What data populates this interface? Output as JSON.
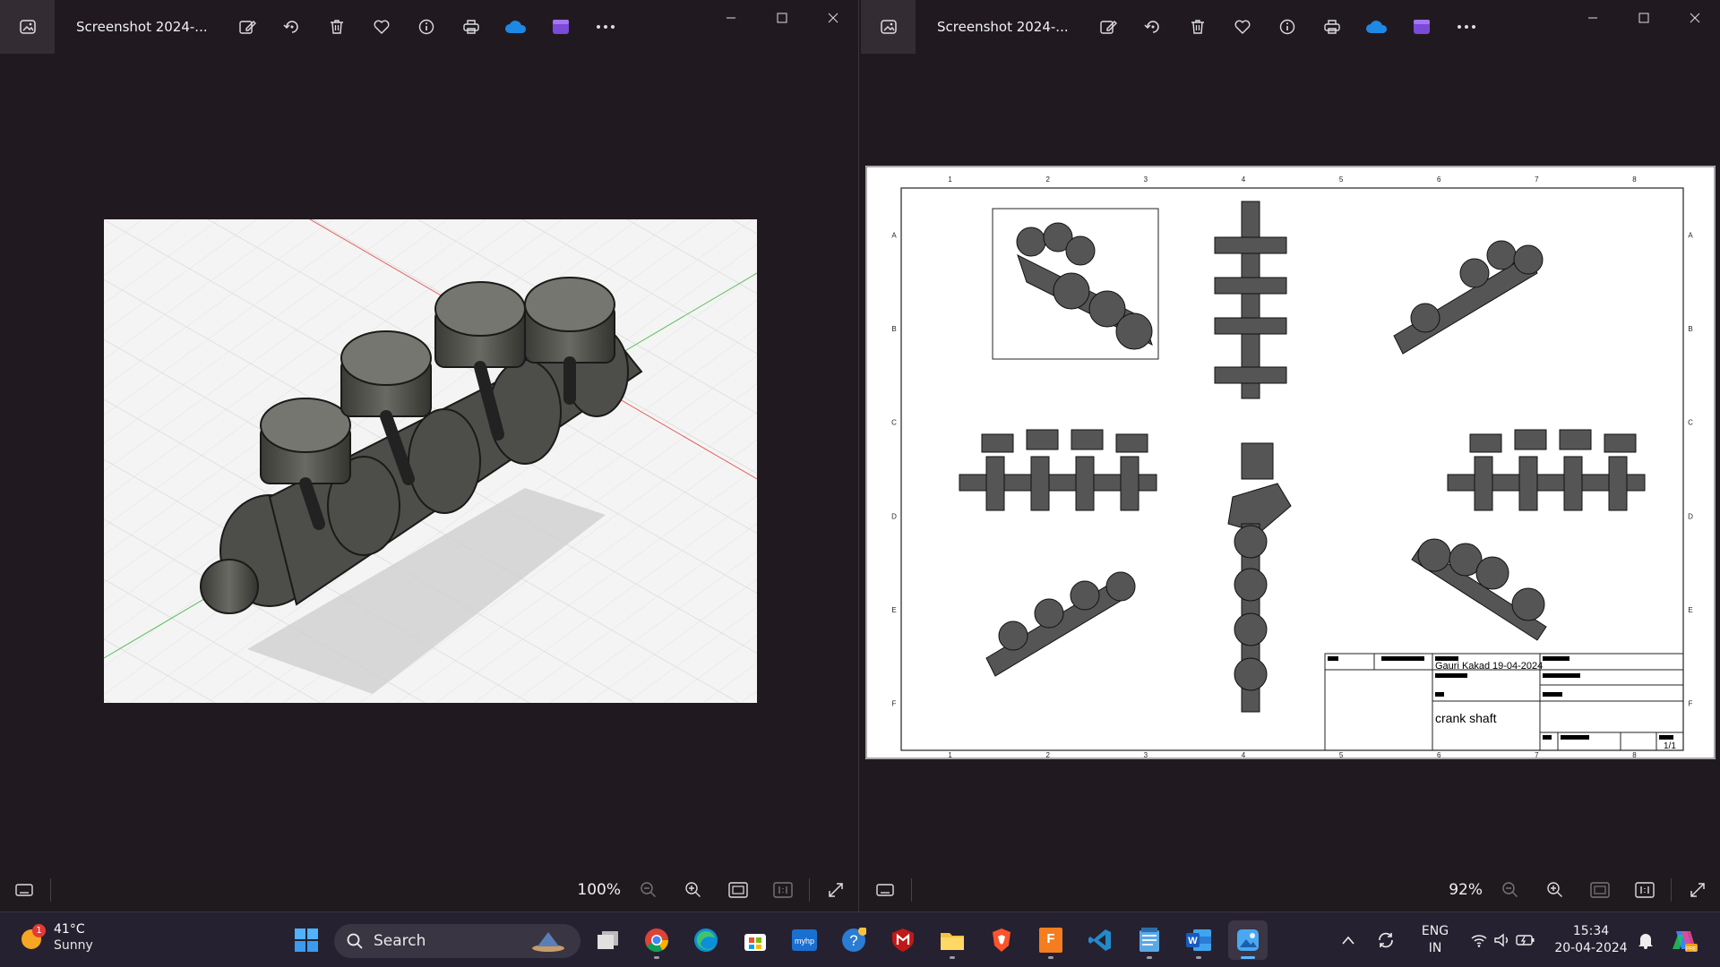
{
  "windows": [
    {
      "title": "Screenshot 2024-...",
      "zoom": "100%",
      "toolbar_icons": [
        "edit-icon",
        "rotate-icon",
        "delete-icon",
        "favorite-icon",
        "info-icon",
        "print-icon",
        "onedrive-icon",
        "clipchamp-icon",
        "more-icon"
      ]
    },
    {
      "title": "Screenshot 2024-...",
      "zoom": "92%",
      "toolbar_icons": [
        "edit-icon",
        "rotate-icon",
        "delete-icon",
        "favorite-icon",
        "info-icon",
        "print-icon",
        "onedrive-icon",
        "clipchamp-icon",
        "more-icon"
      ]
    }
  ],
  "drawing": {
    "col_numbers": [
      "1",
      "2",
      "3",
      "4",
      "5",
      "6",
      "7",
      "8"
    ],
    "row_letters": [
      "A",
      "B",
      "C",
      "D",
      "E",
      "F"
    ],
    "designer": "Gauri Kakad",
    "date": "19-04-2024",
    "title": "crank shaft",
    "sheet": "1/1"
  },
  "taskbar": {
    "weather": {
      "temp": "41°C",
      "condition": "Sunny",
      "badge": "1"
    },
    "search_label": "Search",
    "pinned_apps": [
      "windows-start",
      "task-view",
      "chrome",
      "edge",
      "microsoft-store",
      "myhp",
      "get-help",
      "mcafee",
      "file-explorer",
      "brave",
      "fusion-360",
      "vs-code",
      "notepad",
      "word",
      "photos"
    ],
    "language": "ENG",
    "region": "IN",
    "time": "15:34",
    "date": "20-04-2024"
  },
  "colors": {
    "window_bg": "#201a20",
    "taskbar_bg": "#262130",
    "accent": "#5fb4ff"
  }
}
